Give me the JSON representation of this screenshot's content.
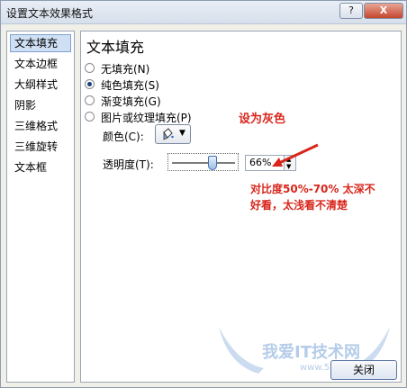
{
  "window": {
    "title": "设置文本效果格式",
    "help_label": "?",
    "close_label": "X"
  },
  "sidebar": {
    "items": [
      {
        "label": "文本填充",
        "selected": true
      },
      {
        "label": "文本边框",
        "selected": false
      },
      {
        "label": "大纲样式",
        "selected": false
      },
      {
        "label": "阴影",
        "selected": false
      },
      {
        "label": "三维格式",
        "selected": false
      },
      {
        "label": "三维旋转",
        "selected": false
      },
      {
        "label": "文本框",
        "selected": false
      }
    ]
  },
  "panel": {
    "section_title": "文本填充",
    "options": [
      {
        "label": "无填充(N)",
        "checked": false
      },
      {
        "label": "纯色填充(S)",
        "checked": true
      },
      {
        "label": "渐变填充(G)",
        "checked": false
      },
      {
        "label": "图片或纹理填充(P)",
        "checked": false
      }
    ],
    "color_label": "颜色(C):",
    "transparency_label": "透明度(T):",
    "transparency_value": "66%",
    "transparency_percent": 66
  },
  "annotations": {
    "set_gray": "设为灰色",
    "contrast_line1": "对比度50%-70%  太深不",
    "contrast_line2": "好看，太浅看不清楚"
  },
  "watermark": {
    "text": "我爱IT技术网",
    "url": "www.52ij.com"
  },
  "footer": {
    "close_label": "关闭"
  },
  "colors": {
    "annotation": "#d8261c",
    "selected_bg": "#cfe0f5",
    "slider_thumb": "#3f6fae"
  }
}
